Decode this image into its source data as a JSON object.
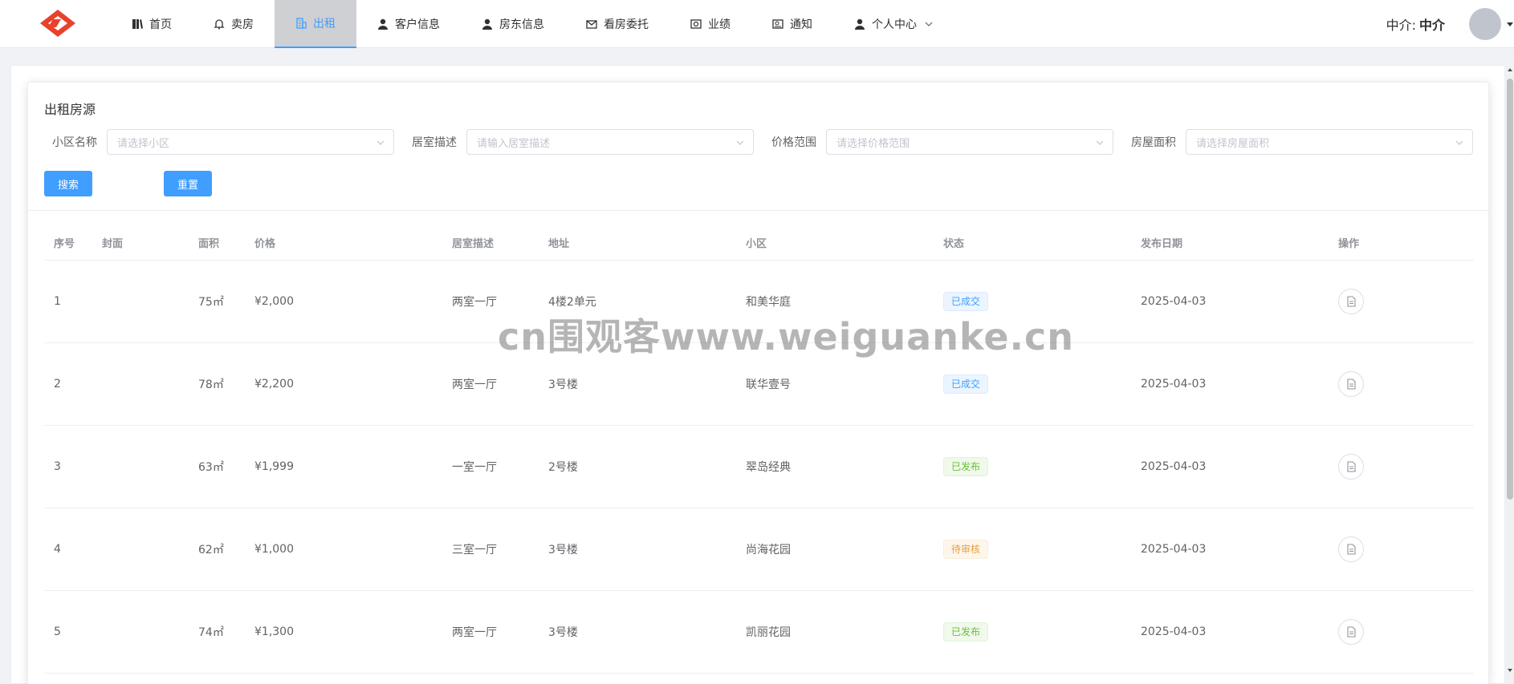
{
  "nav": {
    "items": [
      {
        "label": "首页",
        "icon": "book-icon"
      },
      {
        "label": "卖房",
        "icon": "bell-icon"
      },
      {
        "label": "出租",
        "icon": "building-icon",
        "active": true
      },
      {
        "label": "客户信息",
        "icon": "user-icon"
      },
      {
        "label": "房东信息",
        "icon": "user-icon"
      },
      {
        "label": "看房委托",
        "icon": "mail-icon"
      },
      {
        "label": "业绩",
        "icon": "chart-icon"
      },
      {
        "label": "通知",
        "icon": "notice-icon"
      },
      {
        "label": "个人中心",
        "icon": "user-icon",
        "dropdown": true
      }
    ]
  },
  "user": {
    "label": "中介:",
    "name": "中介"
  },
  "card": {
    "title": "出租房源"
  },
  "filters": {
    "community": {
      "label": "小区名称",
      "placeholder": "请选择小区"
    },
    "room": {
      "label": "居室描述",
      "placeholder": "请输入居室描述"
    },
    "price": {
      "label": "价格范围",
      "placeholder": "请选择价格范围"
    },
    "area": {
      "label": "房屋面积",
      "placeholder": "请选择房屋面积"
    }
  },
  "buttons": {
    "search": "搜索",
    "reset": "重置"
  },
  "table": {
    "headers": [
      "序号",
      "封面",
      "面积",
      "价格",
      "居室描述",
      "地址",
      "小区",
      "状态",
      "发布日期",
      "操作"
    ],
    "rows": [
      {
        "no": "1",
        "area": "75㎡",
        "price": "¥2,000",
        "room": "两室一厅",
        "address": "4楼2单元",
        "community": "和美华庭",
        "status": "已成交",
        "status_type": "done",
        "date": "2025-04-03"
      },
      {
        "no": "2",
        "area": "78㎡",
        "price": "¥2,200",
        "room": "两室一厅",
        "address": "3号楼",
        "community": "联华壹号",
        "status": "已成交",
        "status_type": "done",
        "date": "2025-04-03"
      },
      {
        "no": "3",
        "area": "63㎡",
        "price": "¥1,999",
        "room": "一室一厅",
        "address": "2号楼",
        "community": "翠岛经典",
        "status": "已发布",
        "status_type": "pub",
        "date": "2025-04-03"
      },
      {
        "no": "4",
        "area": "62㎡",
        "price": "¥1,000",
        "room": "三室一厅",
        "address": "3号楼",
        "community": "尚海花园",
        "status": "待审核",
        "status_type": "wait",
        "date": "2025-04-03"
      },
      {
        "no": "5",
        "area": "74㎡",
        "price": "¥1,300",
        "room": "两室一厅",
        "address": "3号楼",
        "community": "凯丽花园",
        "status": "已发布",
        "status_type": "pub",
        "date": "2025-04-03"
      }
    ]
  },
  "watermark": "cn围观客www.weiguanke.cn",
  "colors": {
    "primary": "#409eff",
    "logo": "#e8412c",
    "active_nav_bg": "#cfd0d3"
  }
}
